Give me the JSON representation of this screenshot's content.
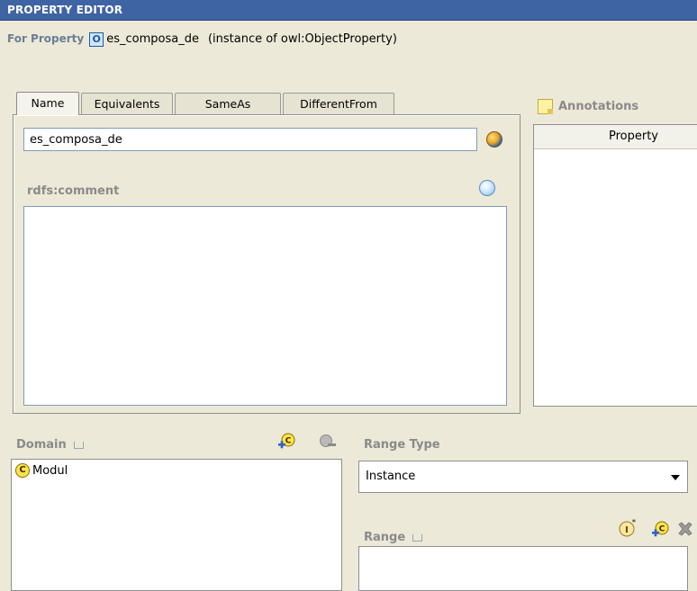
{
  "header": {
    "title": "PROPERTY EDITOR"
  },
  "for_property": {
    "label": "For Property",
    "badge": "O",
    "name": "es_composa_de",
    "instance_of": "(instance of owl:ObjectProperty)"
  },
  "tabs": [
    {
      "label": "Name",
      "active": true
    },
    {
      "label": "Equivalents",
      "active": false
    },
    {
      "label": "SameAs",
      "active": false
    },
    {
      "label": "DifferentFrom",
      "active": false
    }
  ],
  "name_field": {
    "value": "es_composa_de"
  },
  "comment": {
    "label": "rdfs:comment",
    "value": ""
  },
  "annotations": {
    "title": "Annotations",
    "column_header": "Property"
  },
  "domain": {
    "label": "Domain",
    "items": [
      {
        "badge": "C",
        "label": "Modul"
      }
    ]
  },
  "range_type": {
    "label": "Range Type",
    "selected": "Instance"
  },
  "range": {
    "label": "Range"
  },
  "icons": {
    "property_badge": "object-property-icon",
    "lang": "globe-icon",
    "comment_lang": "bubble-icon",
    "note": "note-icon",
    "add_class": "add-class-icon",
    "remove_class": "remove-class-icon",
    "add_instance": "add-instance-icon",
    "delete": "delete-icon"
  }
}
